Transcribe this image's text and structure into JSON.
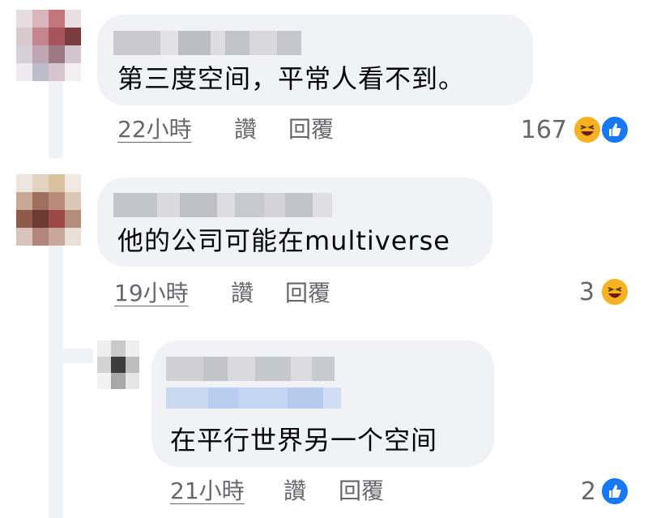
{
  "comments": [
    {
      "text": "第三度空间，平常人看不到。",
      "time": "22小時",
      "like_label": "讚",
      "reply_label": "回覆",
      "reaction_count": "167",
      "reactions": [
        "haha-icon",
        "like-icon"
      ]
    },
    {
      "text": "他的公司可能在multiverse",
      "time": "19小時",
      "like_label": "讚",
      "reply_label": "回覆",
      "reaction_count": "3",
      "reactions": [
        "haha-icon"
      ]
    },
    {
      "text": "在平行世界另一个空间",
      "time": "21小時",
      "like_label": "讚",
      "reply_label": "回覆",
      "reaction_count": "2",
      "reactions": [
        "like-icon"
      ]
    }
  ],
  "colors": {
    "bubble": "#f0f2f5",
    "meta_text": "#65676b",
    "like_blue": "#1877f2",
    "haha_yellow": "#f7b125"
  }
}
